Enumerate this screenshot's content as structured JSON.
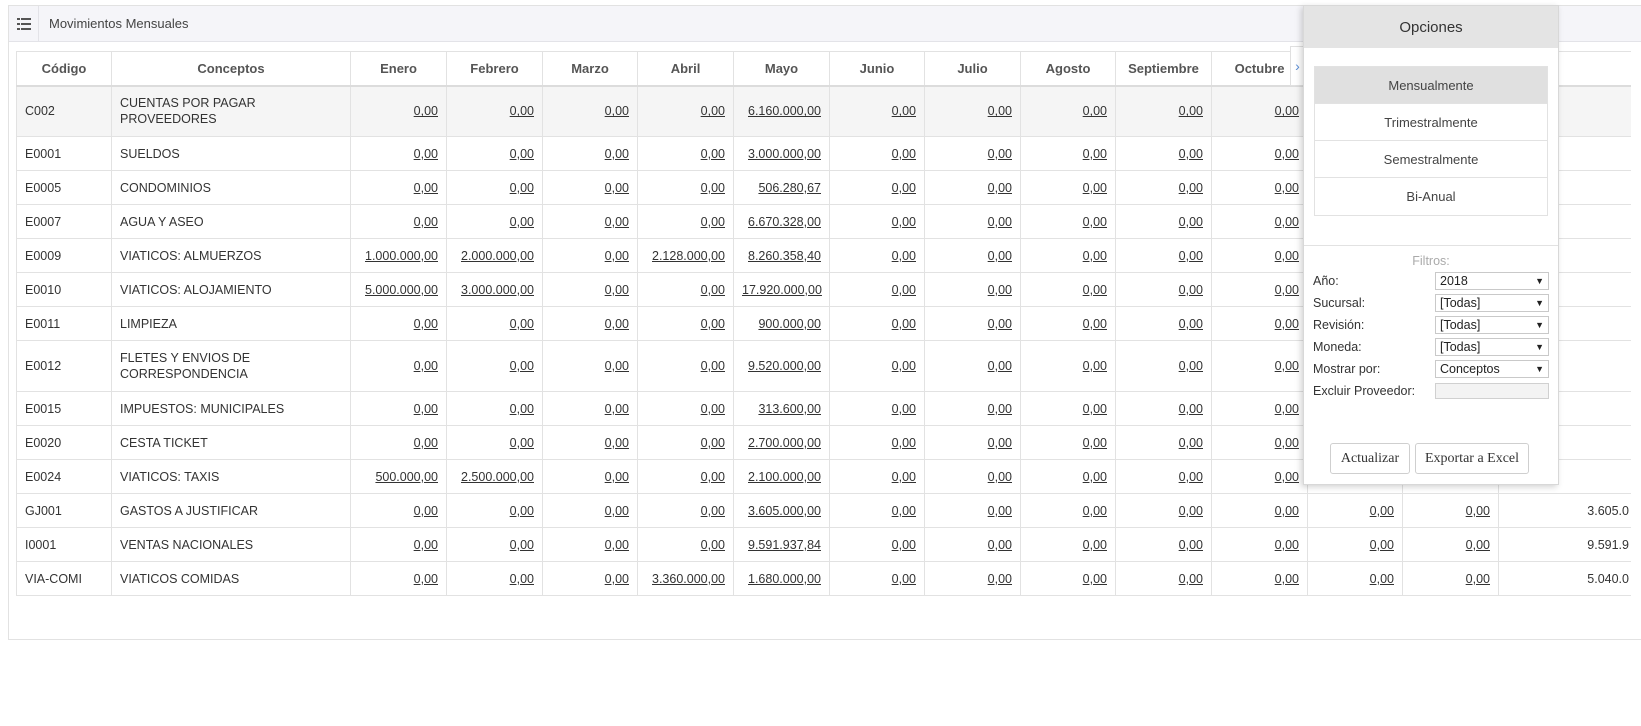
{
  "panel": {
    "title": "Movimientos Mensuales"
  },
  "table": {
    "columns": [
      "Código",
      "Conceptos",
      "Enero",
      "Febrero",
      "Marzo",
      "Abril",
      "Mayo",
      "Junio",
      "Julio",
      "Agosto",
      "Septiembre",
      "Octubre",
      "",
      "",
      ""
    ],
    "rows": [
      {
        "code": "C002",
        "concept": "CUENTAS POR PAGAR PROVEEDORES",
        "values": [
          "0,00",
          "0,00",
          "0,00",
          "0,00",
          "6.160.000,00",
          "0,00",
          "0,00",
          "0,00",
          "0,00",
          "0,00",
          "",
          "",
          ""
        ]
      },
      {
        "code": "E0001",
        "concept": "SUELDOS",
        "values": [
          "0,00",
          "0,00",
          "0,00",
          "0,00",
          "3.000.000,00",
          "0,00",
          "0,00",
          "0,00",
          "0,00",
          "0,00",
          "",
          "",
          ""
        ]
      },
      {
        "code": "E0005",
        "concept": "CONDOMINIOS",
        "values": [
          "0,00",
          "0,00",
          "0,00",
          "0,00",
          "506.280,67",
          "0,00",
          "0,00",
          "0,00",
          "0,00",
          "0,00",
          "",
          "",
          ""
        ]
      },
      {
        "code": "E0007",
        "concept": "AGUA Y ASEO",
        "values": [
          "0,00",
          "0,00",
          "0,00",
          "0,00",
          "6.670.328,00",
          "0,00",
          "0,00",
          "0,00",
          "0,00",
          "0,00",
          "",
          "",
          ""
        ]
      },
      {
        "code": "E0009",
        "concept": "VIATICOS: ALMUERZOS",
        "values": [
          "1.000.000,00",
          "2.000.000,00",
          "0,00",
          "2.128.000,00",
          "8.260.358,40",
          "0,00",
          "0,00",
          "0,00",
          "0,00",
          "0,00",
          "",
          "",
          ""
        ]
      },
      {
        "code": "E0010",
        "concept": "VIATICOS: ALOJAMIENTO",
        "values": [
          "5.000.000,00",
          "3.000.000,00",
          "0,00",
          "0,00",
          "17.920.000,00",
          "0,00",
          "0,00",
          "0,00",
          "0,00",
          "0,00",
          "",
          "",
          ""
        ]
      },
      {
        "code": "E0011",
        "concept": "LIMPIEZA",
        "values": [
          "0,00",
          "0,00",
          "0,00",
          "0,00",
          "900.000,00",
          "0,00",
          "0,00",
          "0,00",
          "0,00",
          "0,00",
          "",
          "",
          ""
        ]
      },
      {
        "code": "E0012",
        "concept": "FLETES Y ENVIOS DE CORRESPONDENCIA",
        "values": [
          "0,00",
          "0,00",
          "0,00",
          "0,00",
          "9.520.000,00",
          "0,00",
          "0,00",
          "0,00",
          "0,00",
          "0,00",
          "",
          "",
          ""
        ]
      },
      {
        "code": "E0015",
        "concept": "IMPUESTOS: MUNICIPALES",
        "values": [
          "0,00",
          "0,00",
          "0,00",
          "0,00",
          "313.600,00",
          "0,00",
          "0,00",
          "0,00",
          "0,00",
          "0,00",
          "",
          "",
          ""
        ]
      },
      {
        "code": "E0020",
        "concept": "CESTA TICKET",
        "values": [
          "0,00",
          "0,00",
          "0,00",
          "0,00",
          "2.700.000,00",
          "0,00",
          "0,00",
          "0,00",
          "0,00",
          "0,00",
          "",
          "",
          ""
        ]
      },
      {
        "code": "E0024",
        "concept": "VIATICOS: TAXIS",
        "values": [
          "500.000,00",
          "2.500.000,00",
          "0,00",
          "0,00",
          "2.100.000,00",
          "0,00",
          "0,00",
          "0,00",
          "0,00",
          "0,00",
          "",
          "",
          ""
        ]
      },
      {
        "code": "GJ001",
        "concept": "GASTOS A JUSTIFICAR",
        "values": [
          "0,00",
          "0,00",
          "0,00",
          "0,00",
          "3.605.000,00",
          "0,00",
          "0,00",
          "0,00",
          "0,00",
          "0,00",
          "0,00",
          "0,00",
          "3.605.0"
        ]
      },
      {
        "code": "I0001",
        "concept": "VENTAS NACIONALES",
        "values": [
          "0,00",
          "0,00",
          "0,00",
          "0,00",
          "9.591.937,84",
          "0,00",
          "0,00",
          "0,00",
          "0,00",
          "0,00",
          "0,00",
          "0,00",
          "9.591.9"
        ]
      },
      {
        "code": "VIA-COMI",
        "concept": "VIATICOS COMIDAS",
        "values": [
          "0,00",
          "0,00",
          "0,00",
          "3.360.000,00",
          "1.680.000,00",
          "0,00",
          "0,00",
          "0,00",
          "0,00",
          "0,00",
          "0,00",
          "0,00",
          "5.040.0"
        ]
      }
    ]
  },
  "options": {
    "title": "Opciones",
    "periods": [
      "Mensualmente",
      "Trimestralmente",
      "Semestralmente",
      "Bi-Anual"
    ],
    "active_period": "Mensualmente",
    "filters_title": "Filtros:",
    "filters": [
      {
        "label": "Año:",
        "value": "2018"
      },
      {
        "label": "Sucursal:",
        "value": "[Todas]"
      },
      {
        "label": "Revisión:",
        "value": "[Todas]"
      },
      {
        "label": "Moneda:",
        "value": "[Todas]"
      },
      {
        "label": "Mostrar por:",
        "value": "Conceptos"
      }
    ],
    "exclude_label": "Excluir Proveedor:",
    "exclude_value": "",
    "update_label": "Actualizar",
    "export_label": "Exportar a Excel"
  },
  "colors": {
    "header_bg": "#f5f5f9",
    "options_header_bg": "#e4e4e4",
    "active_period_bg": "#e0e0e0",
    "arrow": "#5b8ed6"
  },
  "icons": {
    "menu": "list-icon",
    "expand": "chevron-right-icon"
  }
}
